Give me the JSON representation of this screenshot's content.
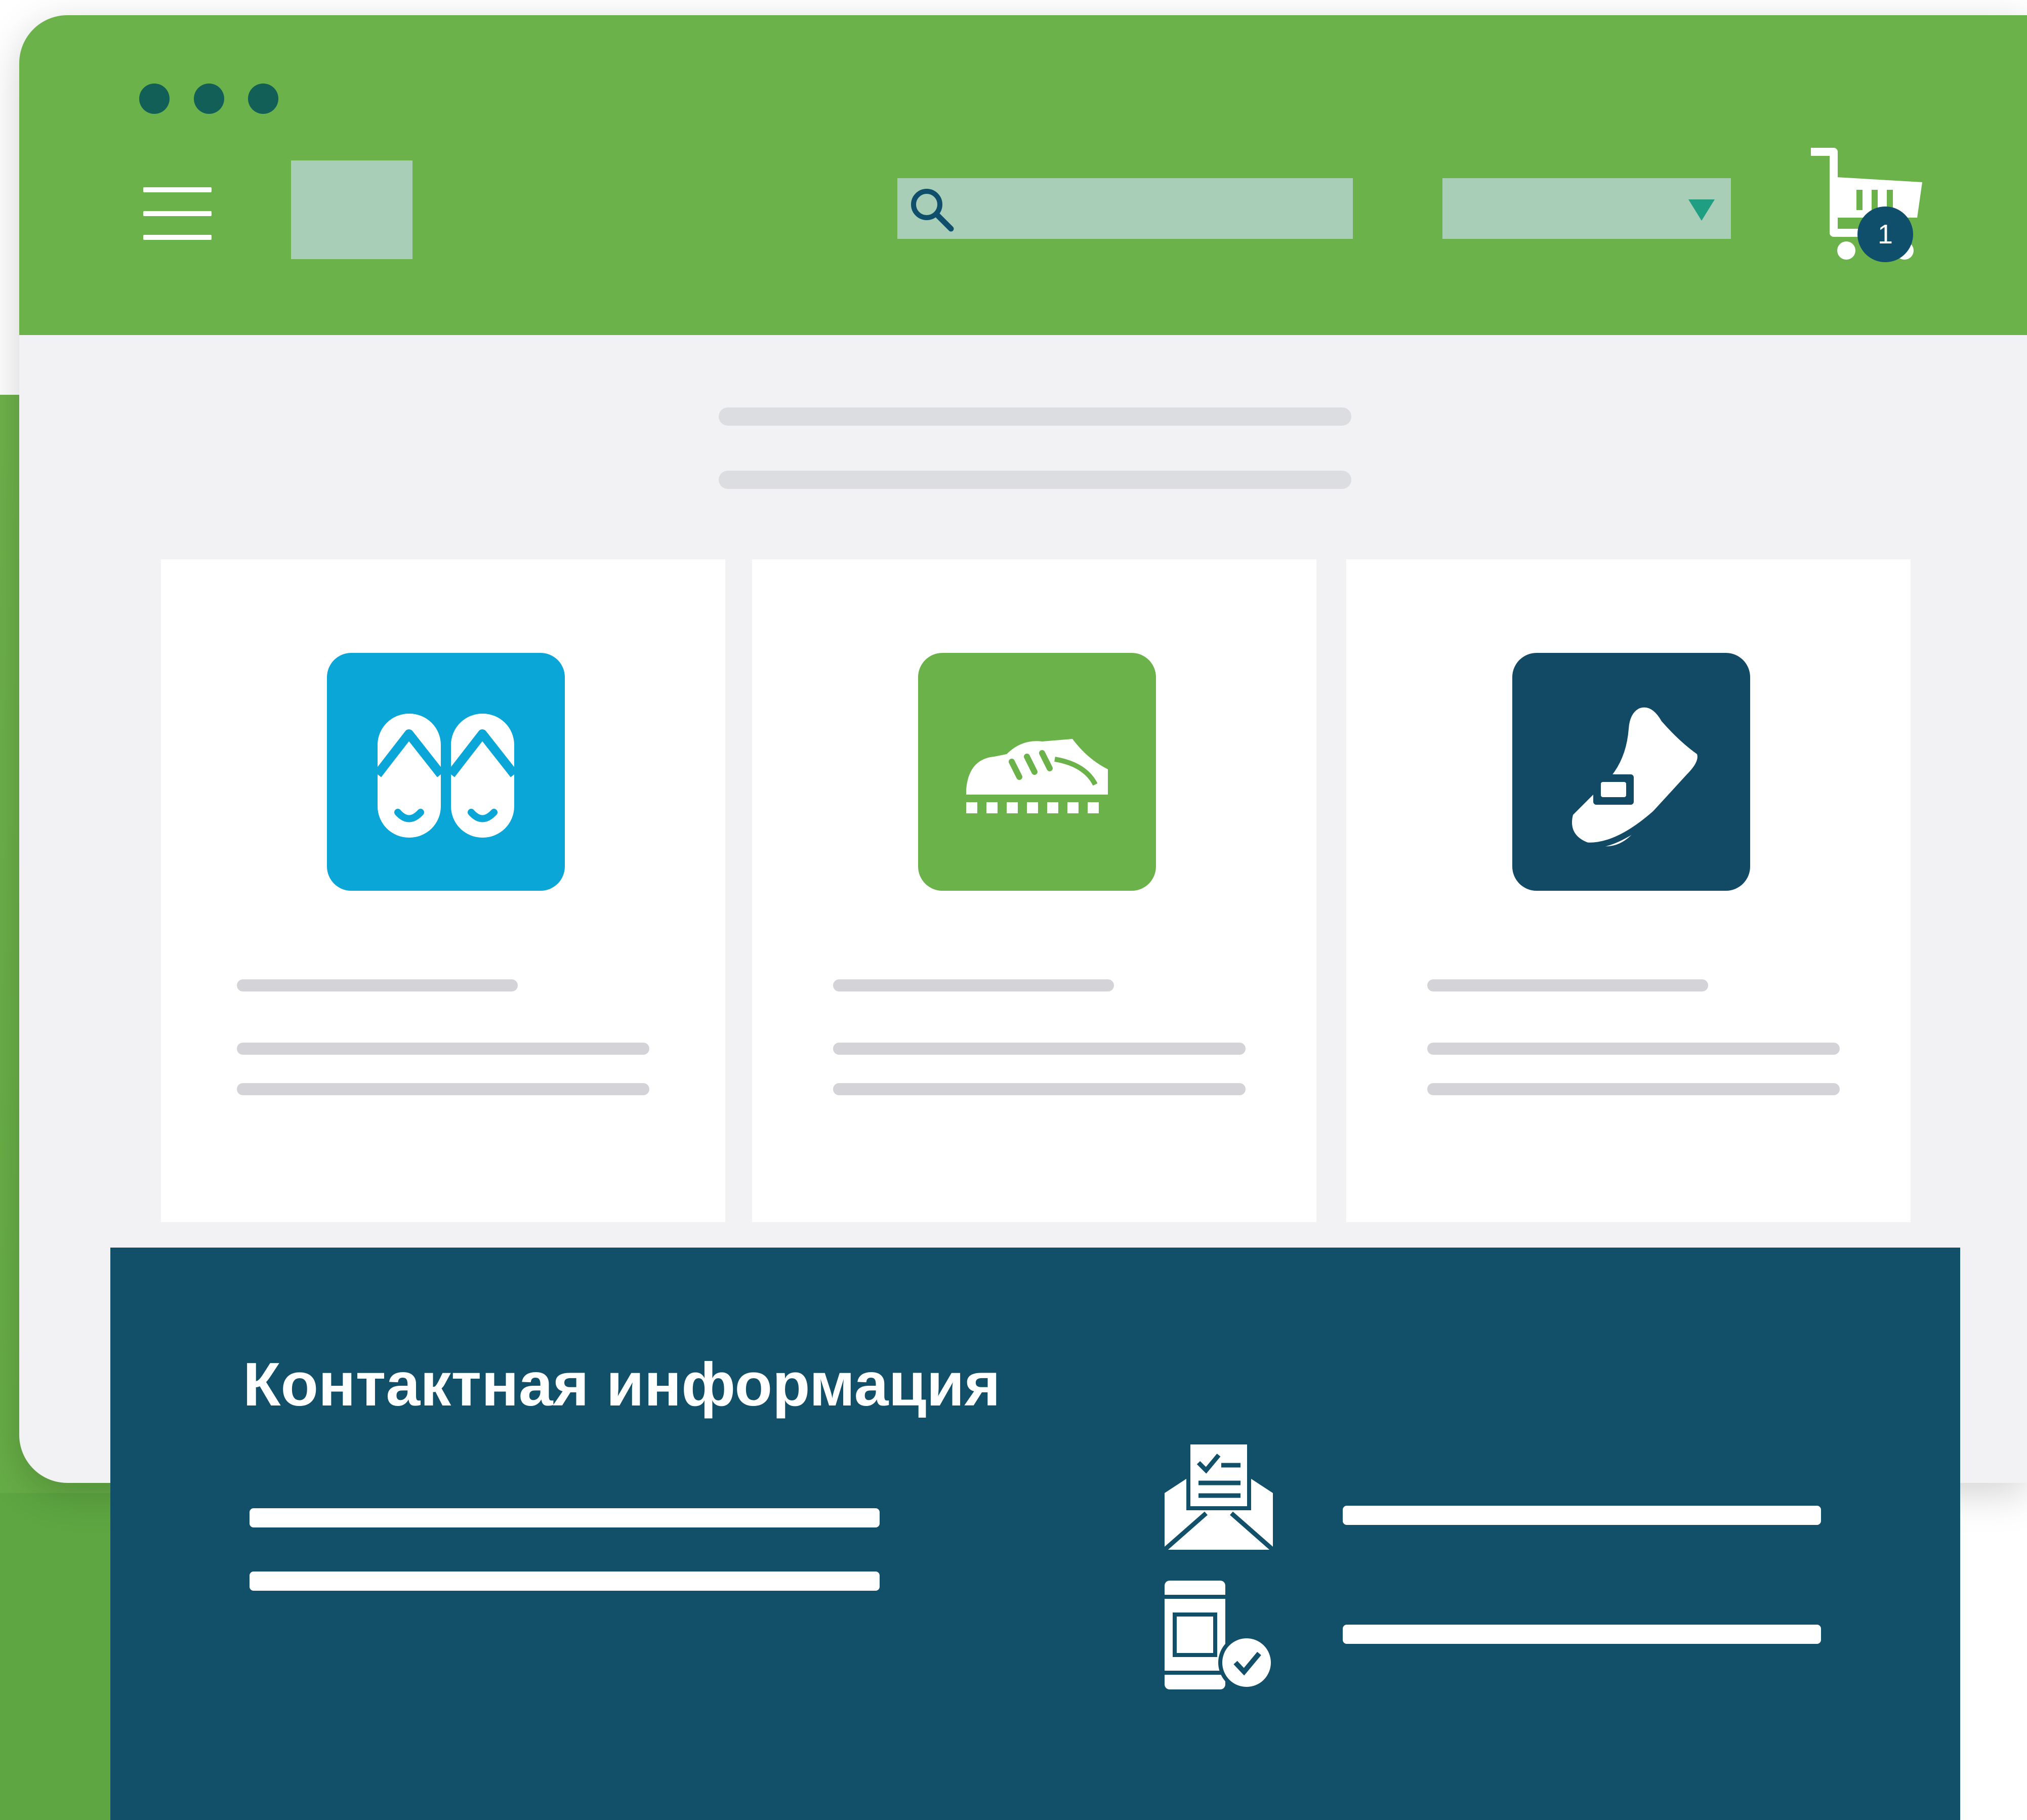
{
  "window_controls": {
    "dots": [
      "dot",
      "dot",
      "dot"
    ],
    "color": "#125f57"
  },
  "header": {
    "background": "#6cb24a",
    "menu_icon": "hamburger-icon",
    "search": {
      "icon": "search-icon",
      "value": "",
      "placeholder": ""
    },
    "select": {
      "icon": "chevron-down-icon",
      "value": ""
    },
    "cart": {
      "icon": "cart-icon",
      "count": "1"
    }
  },
  "categories": [
    {
      "icon": "flip-flops-icon",
      "color": "#0aa6d8"
    },
    {
      "icon": "sneaker-icon",
      "color": "#6cb24a"
    },
    {
      "icon": "running-shoe-icon",
      "color": "#124a66"
    }
  ],
  "contact": {
    "title": "Контактная информация",
    "icons": [
      "email-icon",
      "phone-check-icon"
    ],
    "background": "#125069"
  }
}
